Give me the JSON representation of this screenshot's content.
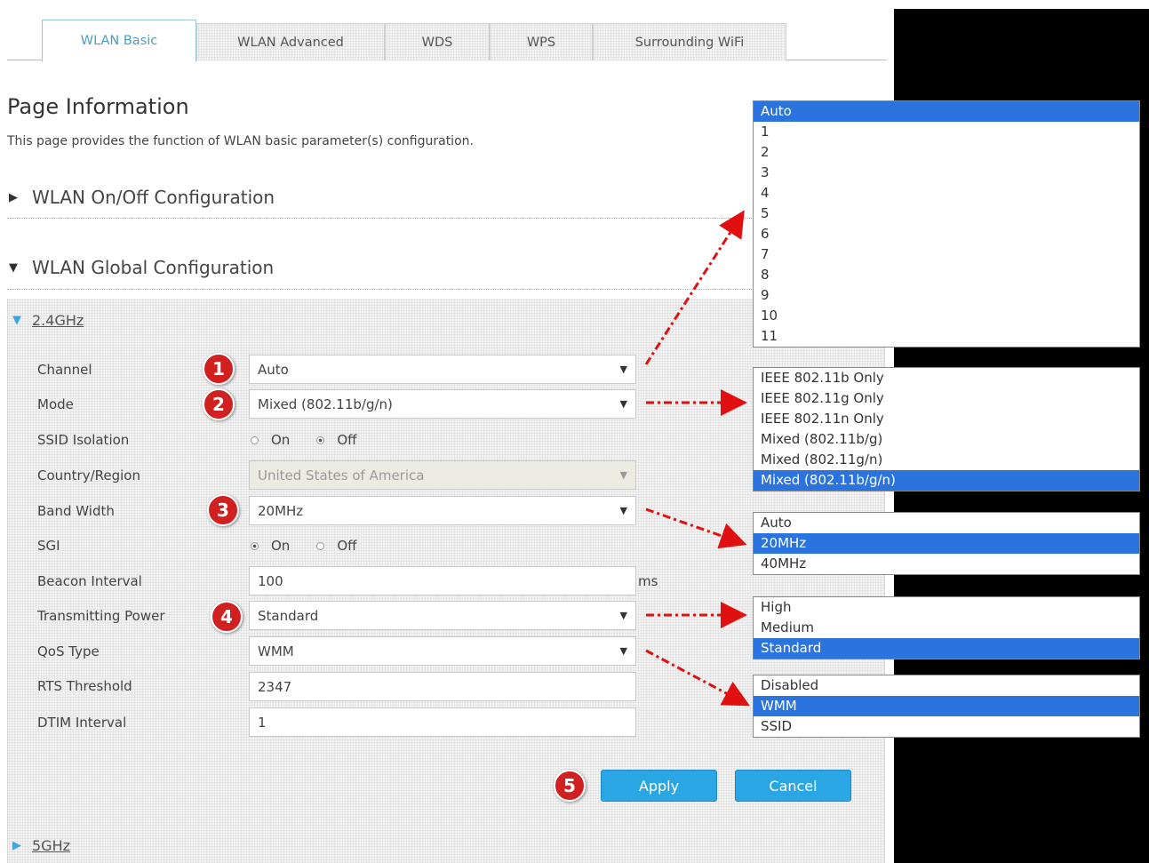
{
  "tabs": [
    "WLAN Basic",
    "WLAN Advanced",
    "WDS",
    "WPS",
    "Surrounding WiFi"
  ],
  "page": {
    "title": "Page Information",
    "description": "This page provides the function of WLAN basic parameter(s) configuration."
  },
  "sections": {
    "onoff": "WLAN On/Off Configuration",
    "global": "WLAN Global Configuration",
    "band24": "2.4GHz",
    "band5": "5GHz"
  },
  "form": {
    "channel": {
      "label": "Channel",
      "value": "Auto"
    },
    "mode": {
      "label": "Mode",
      "value": "Mixed (802.11b/g/n)"
    },
    "ssid_isolation": {
      "label": "SSID Isolation",
      "on": "On",
      "off": "Off",
      "selected": "Off"
    },
    "country": {
      "label": "Country/Region",
      "value": "United States of America"
    },
    "bandwidth": {
      "label": "Band Width",
      "value": "20MHz"
    },
    "sgi": {
      "label": "SGI",
      "on": "On",
      "off": "Off",
      "selected": "On"
    },
    "beacon": {
      "label": "Beacon Interval",
      "value": "100",
      "unit": "ms"
    },
    "tx_power": {
      "label": "Transmitting Power",
      "value": "Standard"
    },
    "qos": {
      "label": "QoS Type",
      "value": "WMM"
    },
    "rts": {
      "label": "RTS Threshold",
      "value": "2347"
    },
    "dtim": {
      "label": "DTIM Interval",
      "value": "1"
    }
  },
  "buttons": {
    "apply": "Apply",
    "cancel": "Cancel"
  },
  "badges": [
    "1",
    "2",
    "3",
    "4",
    "5"
  ],
  "dropdowns": {
    "channel": [
      "Auto",
      "1",
      "2",
      "3",
      "4",
      "5",
      "6",
      "7",
      "8",
      "9",
      "10",
      "11"
    ],
    "mode": [
      "IEEE 802.11b Only",
      "IEEE 802.11g Only",
      "IEEE 802.11n Only",
      "Mixed (802.11b/g)",
      "Mixed (802.11g/n)",
      "Mixed (802.11b/g/n)"
    ],
    "bandwidth": [
      "Auto",
      "20MHz",
      "40MHz"
    ],
    "tx_power": [
      "High",
      "Medium",
      "Standard"
    ],
    "qos": [
      "Disabled",
      "WMM",
      "SSID"
    ]
  },
  "colors": {
    "accent": "#2ba6e4",
    "badge": "#d12020",
    "selected_option": "#2b74e0",
    "arrow": "#e01010"
  }
}
